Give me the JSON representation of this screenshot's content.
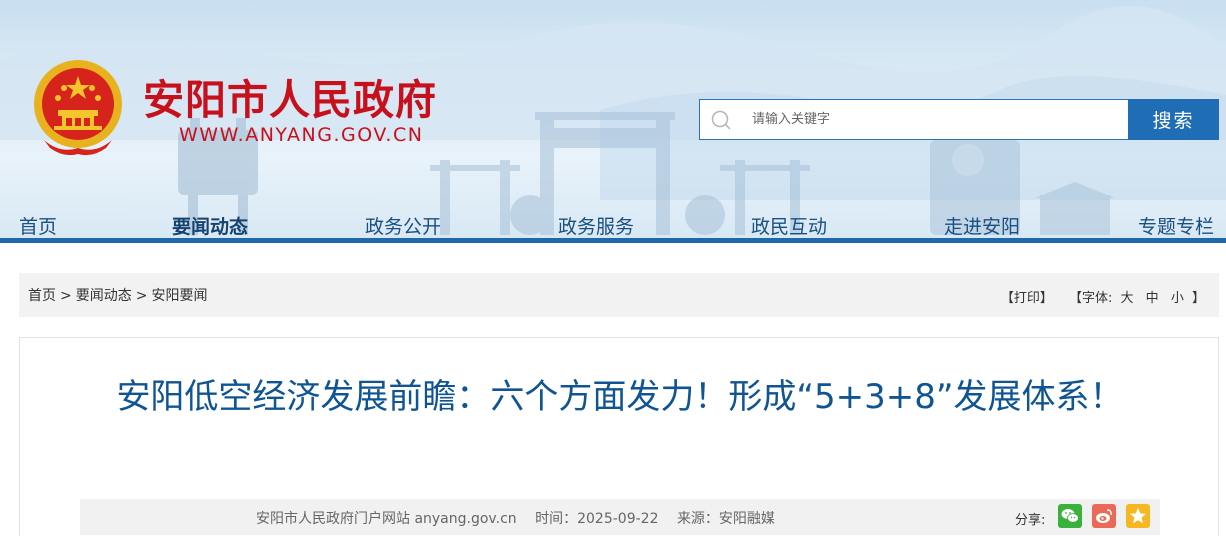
{
  "header": {
    "site_title": "安阳市人民政府",
    "site_url": "WWW.ANYANG.GOV.CN",
    "search": {
      "placeholder": "请输入关键字",
      "button_label": "搜索"
    },
    "nav": [
      {
        "label": "首页",
        "active": false
      },
      {
        "label": "要闻动态",
        "active": true
      },
      {
        "label": "政务公开",
        "active": false
      },
      {
        "label": "政务服务",
        "active": false
      },
      {
        "label": "政民互动",
        "active": false
      },
      {
        "label": "走进安阳",
        "active": false
      },
      {
        "label": "专题专栏",
        "active": false
      }
    ]
  },
  "breadcrumb": {
    "items": [
      "首页",
      "要闻动态",
      "安阳要闻"
    ],
    "separator": ">"
  },
  "tools": {
    "print": "【打印】",
    "font_prefix": "【字体:",
    "font_large": "大",
    "font_medium": "中",
    "font_small": "小",
    "font_suffix": "】"
  },
  "article": {
    "title": "安阳低空经济发展前瞻：六个方面发力！形成“5+3+8”发展体系！",
    "meta": {
      "site": "安阳市人民政府门户网站 anyang.gov.cn",
      "time": "时间：2025-09-22",
      "source": "来源：安阳融媒"
    },
    "share_label": "分享:",
    "share_icons": [
      "wechat-icon",
      "weibo-icon",
      "qzone-icon"
    ]
  },
  "colors": {
    "brand_red": "#c8101c",
    "nav_blue": "#1f69ab",
    "title_blue": "#0f5493",
    "search_button": "#1e6db5"
  }
}
